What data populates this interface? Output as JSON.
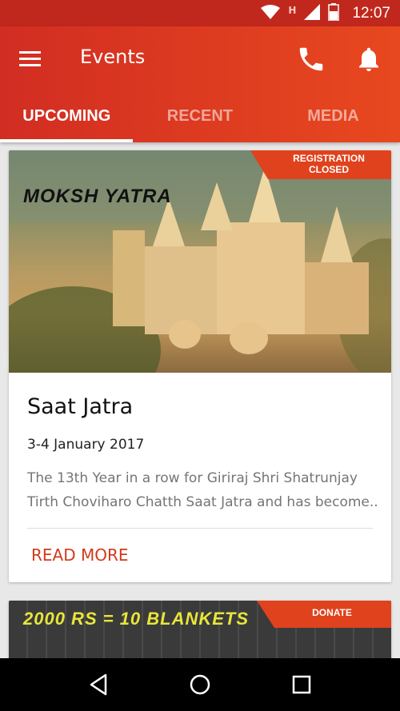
{
  "status_bar": {
    "time": "12:07",
    "network_mark": "H",
    "icons": [
      "wifi-icon",
      "signal-icon",
      "battery-icon"
    ]
  },
  "toolbar": {
    "title": "Events",
    "icons": [
      "menu-icon",
      "phone-icon",
      "bell-icon"
    ]
  },
  "tabs": [
    {
      "label": "UPCOMING",
      "active": true
    },
    {
      "label": "RECENT",
      "active": false
    },
    {
      "label": "MEDIA",
      "active": false
    }
  ],
  "events": [
    {
      "ribbon": "REGISTRATION CLOSED",
      "image_caption": "MOKSH YATRA",
      "title": "Saat Jatra",
      "date": "3-4 January 2017",
      "description_line1": "The 13th Year in a row for  Giriraj Shri Shatrunjay",
      "description_line2": "Tirth Choviharo Chatth Saat Jatra and has become...",
      "action": "READ MORE"
    },
    {
      "ribbon": "DONATE",
      "image_caption": "2000 RS = 10 BLANKETS"
    }
  ],
  "colors": {
    "app_bar_start": "#d22d22",
    "app_bar_end": "#e8481f",
    "status_bar": "#c1281d",
    "ribbon": "#e0421d",
    "accent_text": "#d23a1c"
  },
  "nav_bar": {
    "icons": [
      "back-icon",
      "home-icon",
      "recents-icon"
    ]
  }
}
